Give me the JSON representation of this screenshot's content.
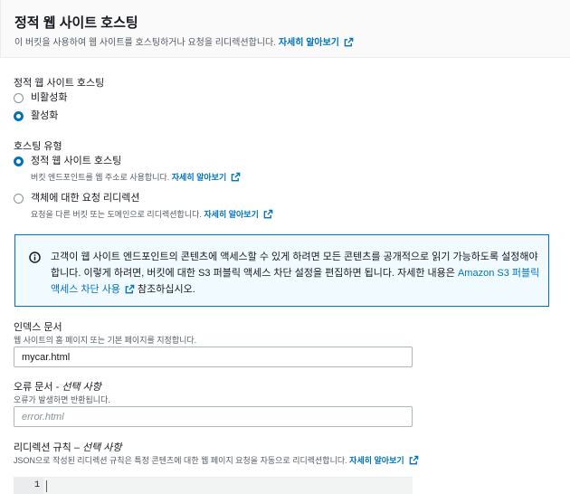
{
  "header": {
    "title": "정적 웹 사이트 호스팅",
    "description": "이 버킷을 사용하여 웹 사이트를 호스팅하거나 요청을 리디렉션합니다.",
    "learn_more": "자세히 알아보기"
  },
  "hosting_section": {
    "label": "정적 웹 사이트 호스팅",
    "options": [
      {
        "label": "비활성화",
        "checked": false
      },
      {
        "label": "활성화",
        "checked": true
      }
    ]
  },
  "hosting_type": {
    "label": "호스팅 유형",
    "options": [
      {
        "label": "정적 웹 사이트 호스팅",
        "description": "버킷 엔드포인트를 웹 주소로 사용합니다.",
        "learn_more": "자세히 알아보기",
        "checked": true
      },
      {
        "label": "객체에 대한 요청 리디렉션",
        "description": "요청을 다른 버킷 또는 도메인으로 리디렉션합니다.",
        "learn_more": "자세히 알아보기",
        "checked": false
      }
    ]
  },
  "info_alert": {
    "text_1": "고객이 웹 사이트 엔드포인트의 콘텐츠에 액세스할 수 있게 하려면 모든 콘텐츠를 공개적으로 읽기 가능하도록 설정해야 합니다. 이렇게 하려면, 버킷에 대한 S3 퍼블릭 액세스 차단 설정을 편집하면 됩니다. 자세한 내용은 ",
    "link": "Amazon S3 퍼블릭 액세스 차단 사용",
    "text_2": "참조하십시오."
  },
  "index_document": {
    "label": "인덱스 문서",
    "description": "웹 사이트의 홈 페이지 또는 기본 페이지를 지정합니다.",
    "value": "mycar.html"
  },
  "error_document": {
    "label": "오류 문서 - ",
    "optional": "선택 사항",
    "description": "오류가 발생하면 반환됩니다.",
    "placeholder": "error.html",
    "value": ""
  },
  "redirect_rules": {
    "label": "리디렉션 규칙 – ",
    "optional": "선택 사항",
    "description": "JSON으로 작성된 리디렉션 규칙은 특정 콘텐츠에 대한 웹 페이지 요청을 자동으로 리디렉션합니다.",
    "learn_more": "자세히 알아보기",
    "line_number": "1"
  },
  "colors": {
    "link": "#0073bb",
    "radio_checked": "#0073bb",
    "info_background": "#f1faff"
  }
}
